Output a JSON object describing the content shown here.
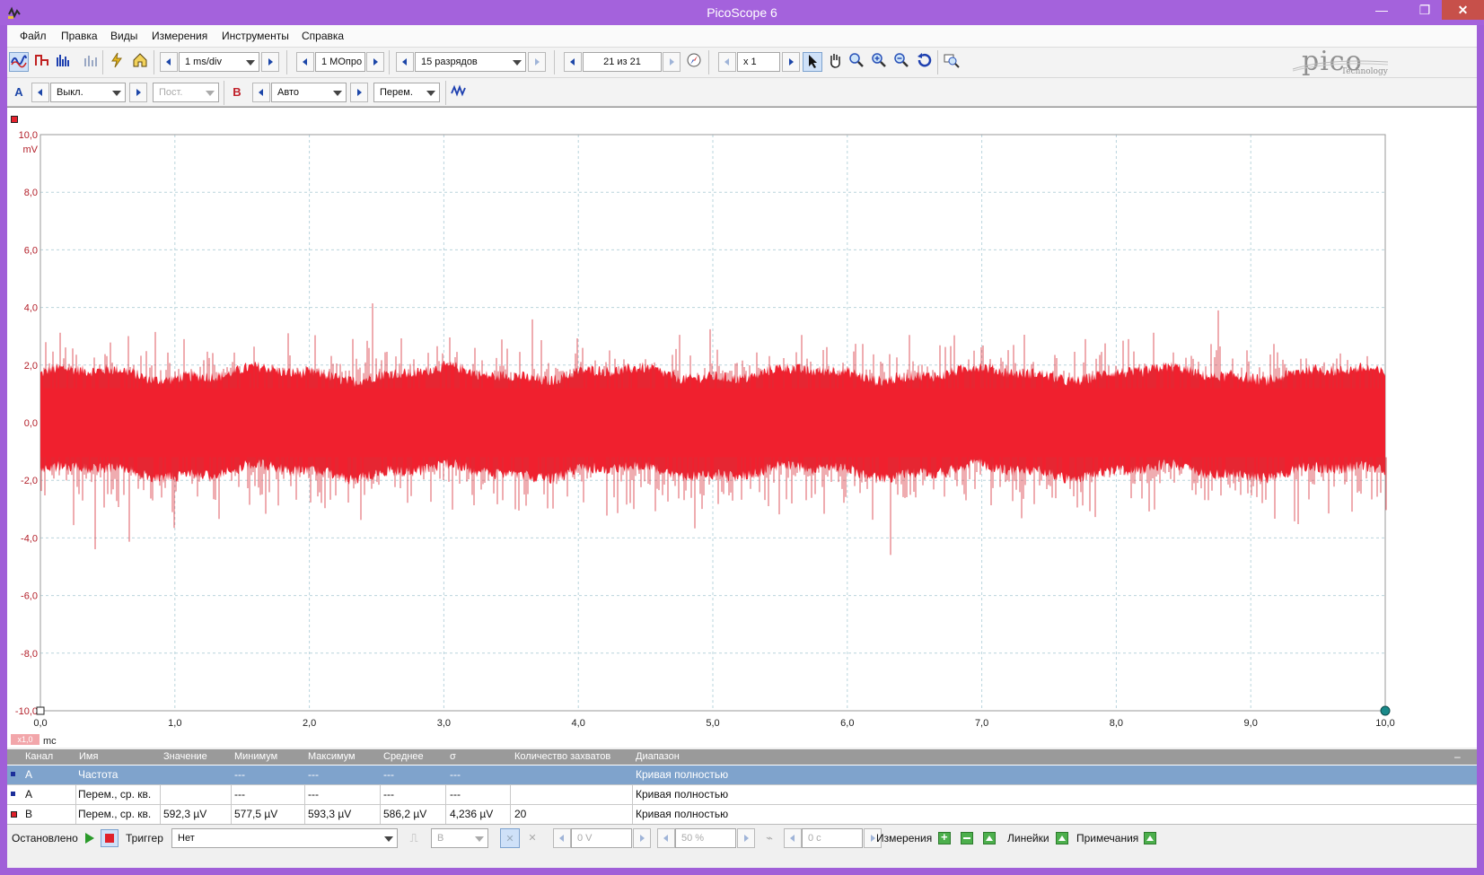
{
  "window": {
    "title": "PicoScope 6",
    "min_glyph": "—",
    "max_glyph": "❐",
    "close_glyph": "✕"
  },
  "menu": [
    "Файл",
    "Правка",
    "Виды",
    "Измерения",
    "Инструменты",
    "Справка"
  ],
  "toolbar": {
    "timebase": "1 ms/div",
    "samples": "1 МОпро",
    "resolution": "15 разрядов",
    "capture": "21 из 21",
    "zoom": "x 1",
    "logo_text": "pico",
    "logo_sub": "Technology"
  },
  "channels": {
    "a_label": "A",
    "a_range": "Выкл.",
    "a_coupling": "Пост.",
    "b_label": "B",
    "b_range": "Авто",
    "b_coupling": "Перем."
  },
  "plot": {
    "y_unit": "mV",
    "x_unit": "mc",
    "x_scale_badge": "x1,0",
    "y_ticks": [
      "10,0",
      "8,0",
      "6,0",
      "4,0",
      "2,0",
      "0,0",
      "-2,0",
      "-4,0",
      "-6,0",
      "-8,0",
      "-10,0"
    ],
    "x_ticks": [
      "0,0",
      "1,0",
      "2,0",
      "3,0",
      "4,0",
      "5,0",
      "6,0",
      "7,0",
      "8,0",
      "9,0",
      "10,0"
    ],
    "trace_color": "#f0202e",
    "axis_color": "#b3202a"
  },
  "chart_data": {
    "type": "line",
    "xlabel": "mc",
    "ylabel": "mV",
    "xlim": [
      0,
      10
    ],
    "ylim": [
      -10,
      10
    ],
    "series": [
      {
        "envelope_rms_mV": 0.586,
        "band_mV": [
          -1.7,
          1.7
        ],
        "peak_mV": [
          -4.8,
          4.2
        ]
      }
    ]
  },
  "measurements": {
    "headers": [
      "Канал",
      "Имя",
      "Значение",
      "Минимум",
      "Максимум",
      "Среднее",
      "σ",
      "Количество захватов",
      "Диапазон"
    ],
    "rows": [
      {
        "channel": "A",
        "name": "Частота",
        "value": "",
        "min": "---",
        "max": "---",
        "avg": "---",
        "sigma": "---",
        "count": "",
        "range": "Кривая полностью"
      },
      {
        "channel": "A",
        "name": "Перем., ср. кв.",
        "value": "",
        "min": "---",
        "max": "---",
        "avg": "---",
        "sigma": "---",
        "count": "",
        "range": "Кривая полностью"
      },
      {
        "channel": "B",
        "name": "Перем., ср. кв.",
        "value": "592,3 µV",
        "min": "577,5 µV",
        "max": "593,3 µV",
        "avg": "586,2 µV",
        "sigma": "4,236 µV",
        "count": "20",
        "range": "Кривая полностью"
      }
    ]
  },
  "status": {
    "state": "Остановлено",
    "trigger_label": "Триггер",
    "trigger_value": "Нет",
    "trigger_channel": "B",
    "threshold": "0 V",
    "pretrigger": "50 %",
    "delay": "0 c",
    "measurements_label": "Измерения",
    "rulers_label": "Линейки",
    "notes_label": "Примечания"
  }
}
